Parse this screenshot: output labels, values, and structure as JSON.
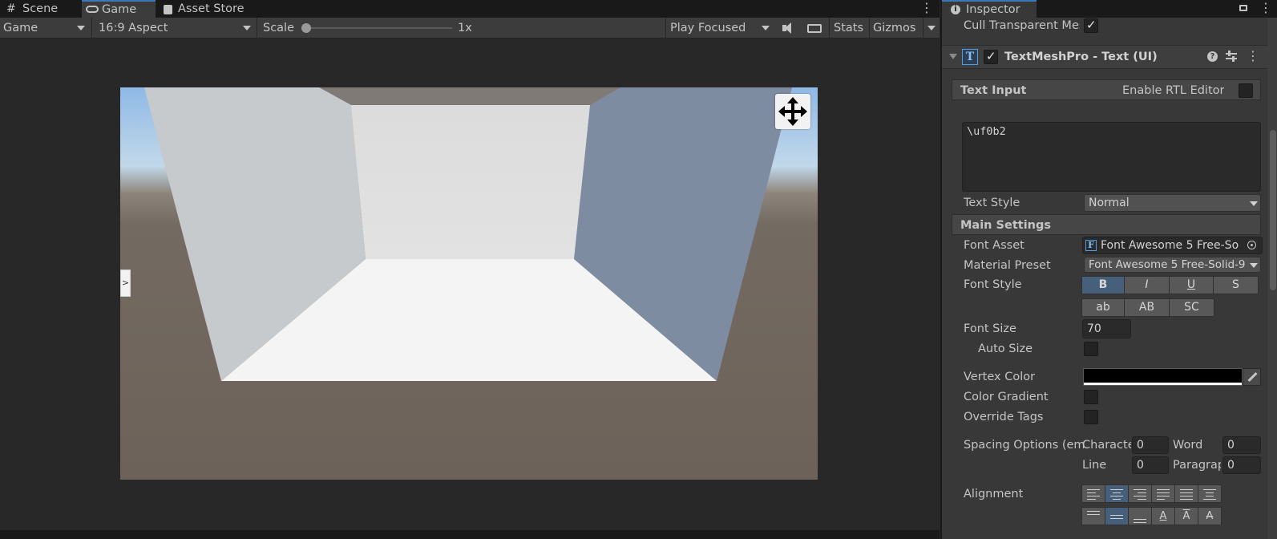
{
  "game_tabs": {
    "scene": {
      "label": "Scene",
      "icon": "grid-icon"
    },
    "game": {
      "label": "Game",
      "icon": "gamepad-icon"
    },
    "asset_store": {
      "label": "Asset Store",
      "icon": "shopping-bag-icon"
    }
  },
  "game_toolbar": {
    "display": "Game",
    "aspect": "16:9 Aspect",
    "scale_label": "Scale",
    "scale_value": "1x",
    "play_mode": "Play Focused",
    "stats": "Stats",
    "gizmos": "Gizmos"
  },
  "viewport": {
    "side_toggle": ">"
  },
  "inspector": {
    "tab_label": "Inspector",
    "cull_transparent_label": "Cull Transparent Mes",
    "component_title": "TextMeshPro - Text (UI)",
    "text_input": {
      "section": "Text Input",
      "rtl_label": "Enable RTL Editor",
      "value": "\\uf0b2"
    },
    "text_style": {
      "label": "Text Style",
      "value": "Normal"
    },
    "main_settings": "Main Settings",
    "font_asset": {
      "label": "Font Asset",
      "value": "Font Awesome 5 Free-So"
    },
    "material_preset": {
      "label": "Material Preset",
      "value": "Font Awesome 5 Free-Solid-9"
    },
    "font_style": {
      "label": "Font Style",
      "row1": [
        "B",
        "I",
        "U",
        "S"
      ],
      "row2": [
        "ab",
        "AB",
        "SC"
      ]
    },
    "font_size": {
      "label": "Font Size",
      "value": "70"
    },
    "auto_size": "Auto Size",
    "vertex_color": "Vertex Color",
    "color_gradient": "Color Gradient",
    "override_tags": "Override Tags",
    "spacing": {
      "label": "Spacing Options (em",
      "character_label": "Characte",
      "character_value": "0",
      "word_label": "Word",
      "word_value": "0",
      "line_label": "Line",
      "line_value": "0",
      "paragraph_label": "Paragrap",
      "paragraph_value": "0"
    },
    "alignment": "Alignment"
  },
  "colors": {
    "accent": "#3a79bb",
    "selected_button": "#46607c",
    "panel_bg": "#383838",
    "editor_bg": "#282828",
    "vertex_color": "#000000"
  }
}
